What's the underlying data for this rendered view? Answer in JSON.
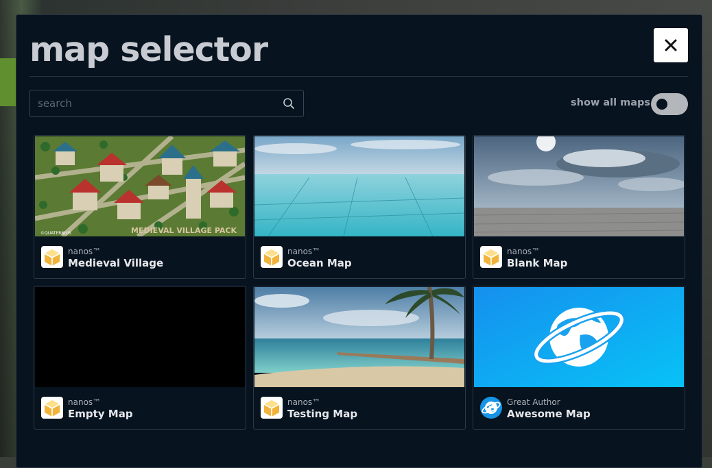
{
  "title": "map selector",
  "search": {
    "placeholder": "search",
    "value": ""
  },
  "toggle": {
    "label": "show all maps",
    "on": false
  },
  "maps": [
    {
      "author": "nanos™",
      "name": "Medieval Village",
      "thumb_caption": "MEDIEVAL VILLAGE PACK",
      "thumb_credit": "©QUATERNIUS",
      "icon": "nanos-cube-icon"
    },
    {
      "author": "nanos™",
      "name": "Ocean Map",
      "icon": "nanos-cube-icon"
    },
    {
      "author": "nanos™",
      "name": "Blank Map",
      "icon": "nanos-cube-icon"
    },
    {
      "author": "nanos™",
      "name": "Empty Map",
      "icon": "nanos-cube-icon"
    },
    {
      "author": "nanos™",
      "name": "Testing Map",
      "icon": "nanos-cube-icon"
    },
    {
      "author": "Great Author",
      "name": "Awesome Map",
      "icon": "globe-icon"
    }
  ],
  "colors": {
    "modal_bg": "#07131f",
    "accent_blue": "#13a9f0",
    "title": "#c8ccd2"
  }
}
